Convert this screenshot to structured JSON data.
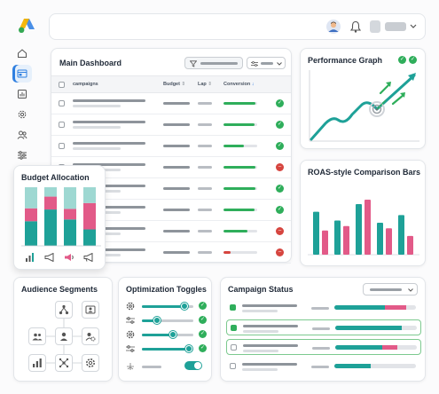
{
  "colors": {
    "teal": "#1ea198",
    "pink": "#e25a88",
    "green": "#2fae5b",
    "red": "#d6453f",
    "blue": "#2f7fe0"
  },
  "topbar": {
    "icons": [
      "google-ads-logo-icon",
      "avatar-icon",
      "bell-icon",
      "chevron-down-icon"
    ]
  },
  "sidebar": {
    "items": [
      "home-icon",
      "dashboard-icon",
      "report-icon",
      "settings-icon",
      "users-icon",
      "filters-icon"
    ],
    "active_index": 1
  },
  "main_dashboard": {
    "title": "Main Dashboard",
    "columns": {
      "campaigns": "campaigns",
      "budget": "Budget",
      "lap": "Lap",
      "conversion": "Conversion"
    },
    "rows": [
      {
        "conversion_pct": 0.95,
        "conversion_color": "green",
        "status": "ok"
      },
      {
        "conversion_pct": 0.92,
        "conversion_color": "green",
        "status": "ok"
      },
      {
        "conversion_pct": 0.6,
        "conversion_color": "green",
        "status": "ok"
      },
      {
        "conversion_pct": 0.95,
        "conversion_color": "green",
        "status": "bad"
      },
      {
        "conversion_pct": 0.95,
        "conversion_color": "green",
        "status": "ok"
      },
      {
        "conversion_pct": 0.92,
        "conversion_color": "green",
        "status": "ok"
      },
      {
        "conversion_pct": 0.7,
        "conversion_color": "green",
        "status": "bad"
      },
      {
        "conversion_pct": 0.2,
        "conversion_color": "red",
        "status": "bad"
      }
    ]
  },
  "performance_graph": {
    "title": "Performance Graph"
  },
  "roas": {
    "title": "ROAS-style Comparison Bars",
    "chart_data": {
      "type": "bar",
      "series": [
        {
          "color": "#1ea198",
          "values": [
            0.78,
            0.62,
            0.92,
            0.58,
            0.72
          ]
        },
        {
          "color": "#e25a88",
          "values": [
            0.44,
            0.52,
            1.0,
            0.48,
            0.34
          ]
        }
      ]
    }
  },
  "budget_allocation": {
    "title": "Budget Allocation",
    "chart_data": {
      "type": "bar",
      "stacks": [
        {
          "teal": 0.42,
          "pink": 0.22,
          "mint": 0.36
        },
        {
          "teal": 0.62,
          "pink": 0.22,
          "mint": 0.16
        },
        {
          "teal": 0.45,
          "pink": 0.18,
          "mint": 0.37
        },
        {
          "teal": 0.28,
          "pink": 0.45,
          "mint": 0.27
        }
      ]
    },
    "footer_icons": [
      "bar-chart-icon",
      "megaphone-icon",
      "broadcast-icon",
      "announcement-icon"
    ]
  },
  "audience_segments": {
    "title": "Audience Segments",
    "icons": [
      "network-icon",
      "profile-card-icon",
      "group-icon",
      "person-icon",
      "user-settings-icon",
      "bar-chart-icon",
      "share-nodes-icon",
      "gear-icon"
    ]
  },
  "optimization_toggles": {
    "title": "Optimization Toggles",
    "rows": [
      {
        "icon": "gear-icon",
        "level": 0.82
      },
      {
        "icon": "sliders-icon",
        "level": 0.3
      },
      {
        "icon": "gear-icon",
        "level": 0.6
      },
      {
        "icon": "sliders-icon",
        "level": 0.92
      }
    ],
    "switch_on": true
  },
  "campaign_status": {
    "title": "Campaign Status",
    "rows": [
      {
        "teal": 0.62,
        "pink": 0.26,
        "selected": false,
        "checked": true
      },
      {
        "teal": 0.82,
        "pink": 0.0,
        "selected": true,
        "checked": true
      },
      {
        "teal": 0.58,
        "pink": 0.18,
        "selected": true,
        "checked": false
      },
      {
        "teal": 0.45,
        "pink": 0.0,
        "selected": false,
        "checked": false
      }
    ]
  }
}
